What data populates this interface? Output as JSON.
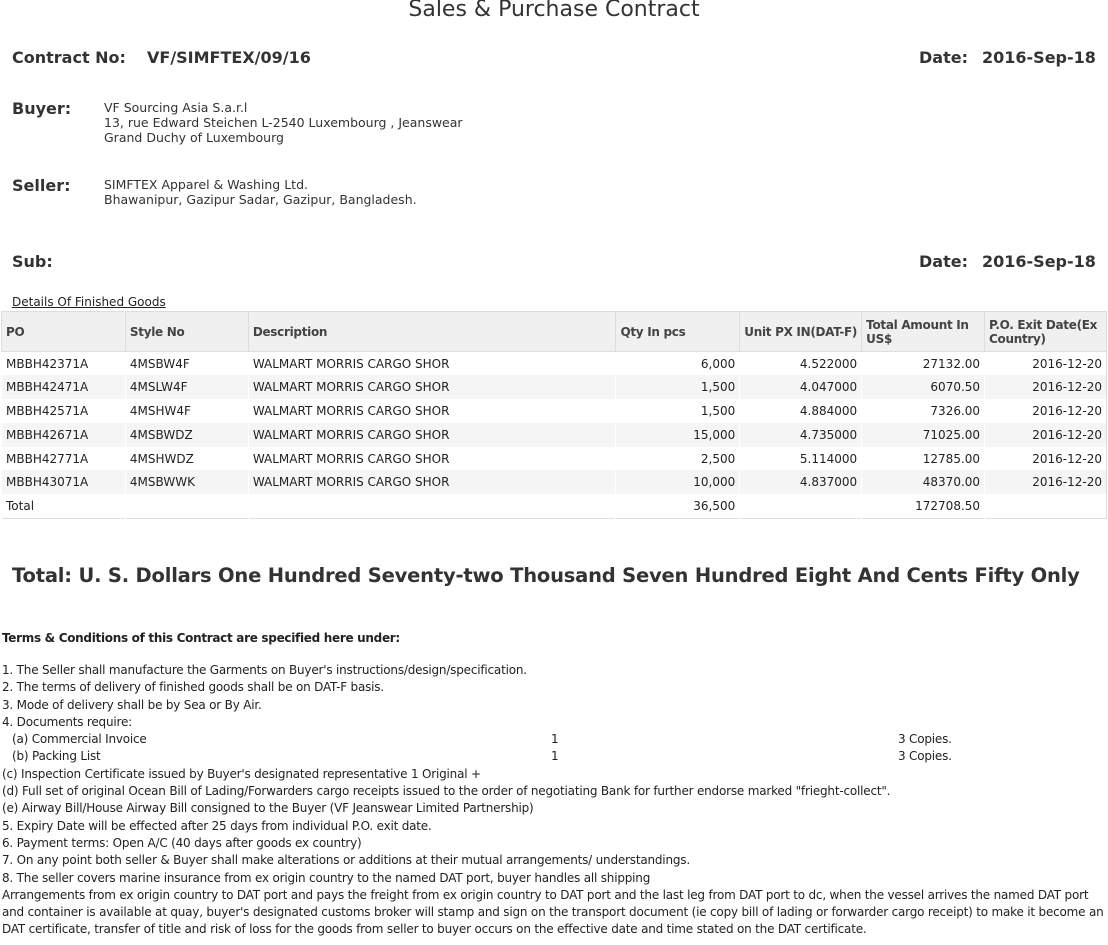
{
  "title": "Sales & Purchase Contract",
  "contract": {
    "label": "Contract No:",
    "value": "VF/SIMFTEX/09/16",
    "date_label": "Date:",
    "date": "2016-Sep-18"
  },
  "buyer": {
    "label": "Buyer:",
    "lines": [
      "VF Sourcing Asia S.a.r.l",
      "13, rue Edward Steichen L-2540 Luxembourg , Jeanswear",
      "Grand Duchy of Luxembourg"
    ]
  },
  "seller": {
    "label": "Seller:",
    "lines": [
      "SIMFTEX Apparel & Washing Ltd.",
      "Bhawanipur, Gazipur Sadar, Gazipur, Bangladesh."
    ]
  },
  "sub": {
    "label": "Sub:",
    "date_label": "Date:",
    "date": "2016-Sep-18"
  },
  "details_label": "Details Of Finished Goods",
  "table": {
    "headers": [
      "PO",
      "Style No",
      "Description",
      "Qty In pcs",
      "Unit PX IN(DAT-F)",
      "Total Amount In US$",
      "P.O. Exit Date(Ex Country)"
    ],
    "rows": [
      [
        "MBBH42371A",
        "4MSBW4F",
        "WALMART MORRIS CARGO SHOR",
        "6,000",
        "4.522000",
        "27132.00",
        "2016-12-20"
      ],
      [
        "MBBH42471A",
        "4MSLW4F",
        "WALMART MORRIS CARGO SHOR",
        "1,500",
        "4.047000",
        "6070.50",
        "2016-12-20"
      ],
      [
        "MBBH42571A",
        "4MSHW4F",
        "WALMART MORRIS CARGO SHOR",
        "1,500",
        "4.884000",
        "7326.00",
        "2016-12-20"
      ],
      [
        "MBBH42671A",
        "4MSBWDZ",
        "WALMART MORRIS CARGO SHOR",
        "15,000",
        "4.735000",
        "71025.00",
        "2016-12-20"
      ],
      [
        "MBBH42771A",
        "4MSHWDZ",
        "WALMART MORRIS CARGO SHOR",
        "2,500",
        "5.114000",
        "12785.00",
        "2016-12-20"
      ],
      [
        "MBBH43071A",
        "4MSBWWK",
        "WALMART MORRIS CARGO SHOR",
        "10,000",
        "4.837000",
        "48370.00",
        "2016-12-20"
      ]
    ],
    "total": {
      "label": "Total",
      "qty": "36,500",
      "amount": "172708.50"
    }
  },
  "total_words": "Total: U. S. Dollars One Hundred Seventy-two Thousand Seven Hundred Eight And Cents Fifty Only",
  "terms_heading": "Terms & Conditions of this Contract are specified here under:",
  "terms": {
    "t1": "1. The Seller shall manufacture the Garments on Buyer's instructions/design/specification.",
    "t2": "2. The terms of delivery of finished goods shall be on DAT-F basis.",
    "t3": "3. Mode of delivery shall be by Sea or By Air.",
    "t4": "4. Documents require:",
    "docs": [
      {
        "name": "(a) Commercial Invoice",
        "originals": "1",
        "copies": "3 Copies."
      },
      {
        "name": "(b) Packing List",
        "originals": "1",
        "copies": "3 Copies."
      }
    ],
    "tc": "(c) Inspection Certificate issued by Buyer's designated representative 1 Original +",
    "td": "(d) Full set of original Ocean Bill of Lading/Forwarders cargo receipts issued to the order of negotiating Bank for further endorse marked \"frieght-collect\".",
    "te": "(e) Airway Bill/House Airway Bill consigned to the Buyer (VF Jeanswear Limited Partnership)",
    "t5": "5. Expiry Date will be effected after 25 days from individual P.O. exit date.",
    "t6": "6. Payment terms: Open A/C (40 days after goods ex country)",
    "t7": "7. On any point both seller & Buyer shall make alterations or additions at their mutual arrangements/ understandings.",
    "t8": "8. The seller covers marine insurance from ex origin country to the named DAT port, buyer handles all shipping",
    "arrangements": "Arrangements from ex origin country to DAT port and pays the freight from ex origin country to DAT port and the last leg from DAT port to dc, when the vessel arrives the named DAT port and container is available at quay, buyer's designated customs broker will stamp and sign on the transport document (ie copy bill of lading or forwarder cargo receipt) to make it become an DAT certificate, transfer of title and risk of loss for the goods from seller to buyer occurs on the effective date and time stated on the DAT certificate."
  }
}
